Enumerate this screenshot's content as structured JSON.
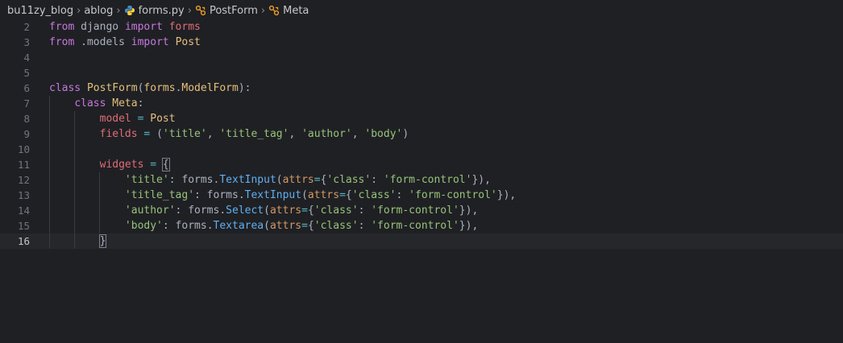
{
  "breadcrumb": {
    "items": [
      {
        "label": "bu11zy_blog",
        "icon": ""
      },
      {
        "label": "ablog",
        "icon": ""
      },
      {
        "label": "forms.py",
        "icon": "python-icon"
      },
      {
        "label": "PostForm",
        "icon": "class-icon"
      },
      {
        "label": "Meta",
        "icon": "class-icon"
      }
    ]
  },
  "colors": {
    "keyword": "#c678dd",
    "class": "#e5c07b",
    "function": "#61afef",
    "string": "#98c379",
    "variable": "#e06c75",
    "background": "#1f2024"
  },
  "editor": {
    "current_line": 16,
    "lines": [
      {
        "n": "2",
        "tokens": [
          [
            "kw",
            "from"
          ],
          [
            "plain",
            " django "
          ],
          [
            "kw",
            "import"
          ],
          [
            "plain",
            " "
          ],
          [
            "var",
            "forms"
          ]
        ]
      },
      {
        "n": "3",
        "tokens": [
          [
            "kw",
            "from"
          ],
          [
            "plain",
            " .models "
          ],
          [
            "kw",
            "import"
          ],
          [
            "plain",
            " "
          ],
          [
            "cls",
            "Post"
          ]
        ]
      },
      {
        "n": "4",
        "tokens": []
      },
      {
        "n": "5",
        "tokens": []
      },
      {
        "n": "6",
        "tokens": [
          [
            "kw",
            "class"
          ],
          [
            "plain",
            " "
          ],
          [
            "cls",
            "PostForm"
          ],
          [
            "pun",
            "("
          ],
          [
            "cls",
            "forms"
          ],
          [
            "pun",
            "."
          ],
          [
            "cls",
            "ModelForm"
          ],
          [
            "pun",
            "):"
          ]
        ]
      },
      {
        "n": "7",
        "tokens": [
          [
            "plain",
            "    "
          ],
          [
            "kw",
            "class"
          ],
          [
            "plain",
            " "
          ],
          [
            "cls",
            "Meta"
          ],
          [
            "pun",
            ":"
          ]
        ]
      },
      {
        "n": "8",
        "tokens": [
          [
            "plain",
            "        "
          ],
          [
            "var",
            "model"
          ],
          [
            "plain",
            " "
          ],
          [
            "op",
            "="
          ],
          [
            "plain",
            " "
          ],
          [
            "cls",
            "Post"
          ]
        ]
      },
      {
        "n": "9",
        "tokens": [
          [
            "plain",
            "        "
          ],
          [
            "var",
            "fields"
          ],
          [
            "plain",
            " "
          ],
          [
            "op",
            "="
          ],
          [
            "plain",
            " ("
          ],
          [
            "str",
            "'title'"
          ],
          [
            "pun",
            ", "
          ],
          [
            "str",
            "'title_tag'"
          ],
          [
            "pun",
            ", "
          ],
          [
            "str",
            "'author'"
          ],
          [
            "pun",
            ", "
          ],
          [
            "str",
            "'body'"
          ],
          [
            "pun",
            ")"
          ]
        ]
      },
      {
        "n": "10",
        "tokens": []
      },
      {
        "n": "11",
        "tokens": [
          [
            "plain",
            "        "
          ],
          [
            "var",
            "widgets"
          ],
          [
            "plain",
            " "
          ],
          [
            "op",
            "="
          ],
          [
            "plain",
            " "
          ],
          [
            "pun",
            "{"
          ]
        ]
      },
      {
        "n": "12",
        "tokens": [
          [
            "plain",
            "            "
          ],
          [
            "str",
            "'title'"
          ],
          [
            "pun",
            ": "
          ],
          [
            "plain",
            "forms"
          ],
          [
            "pun",
            "."
          ],
          [
            "fn",
            "TextInput"
          ],
          [
            "pun",
            "("
          ],
          [
            "pname",
            "attrs"
          ],
          [
            "op",
            "="
          ],
          [
            "pun",
            "{"
          ],
          [
            "str",
            "'class'"
          ],
          [
            "pun",
            ": "
          ],
          [
            "str",
            "'form-control'"
          ],
          [
            "pun",
            "}),"
          ]
        ]
      },
      {
        "n": "13",
        "tokens": [
          [
            "plain",
            "            "
          ],
          [
            "str",
            "'title_tag'"
          ],
          [
            "pun",
            ": "
          ],
          [
            "plain",
            "forms"
          ],
          [
            "pun",
            "."
          ],
          [
            "fn",
            "TextInput"
          ],
          [
            "pun",
            "("
          ],
          [
            "pname",
            "attrs"
          ],
          [
            "op",
            "="
          ],
          [
            "pun",
            "{"
          ],
          [
            "str",
            "'class'"
          ],
          [
            "pun",
            ": "
          ],
          [
            "str",
            "'form-control'"
          ],
          [
            "pun",
            "}),"
          ]
        ]
      },
      {
        "n": "14",
        "tokens": [
          [
            "plain",
            "            "
          ],
          [
            "str",
            "'author'"
          ],
          [
            "pun",
            ": "
          ],
          [
            "plain",
            "forms"
          ],
          [
            "pun",
            "."
          ],
          [
            "fn",
            "Select"
          ],
          [
            "pun",
            "("
          ],
          [
            "pname",
            "attrs"
          ],
          [
            "op",
            "="
          ],
          [
            "pun",
            "{"
          ],
          [
            "str",
            "'class'"
          ],
          [
            "pun",
            ": "
          ],
          [
            "str",
            "'form-control'"
          ],
          [
            "pun",
            "}),"
          ]
        ]
      },
      {
        "n": "15",
        "tokens": [
          [
            "plain",
            "            "
          ],
          [
            "str",
            "'body'"
          ],
          [
            "pun",
            ": "
          ],
          [
            "plain",
            "forms"
          ],
          [
            "pun",
            "."
          ],
          [
            "fn",
            "Textarea"
          ],
          [
            "pun",
            "("
          ],
          [
            "pname",
            "attrs"
          ],
          [
            "op",
            "="
          ],
          [
            "pun",
            "{"
          ],
          [
            "str",
            "'class'"
          ],
          [
            "pun",
            ": "
          ],
          [
            "str",
            "'form-control'"
          ],
          [
            "pun",
            "}),"
          ]
        ]
      },
      {
        "n": "16",
        "tokens": [
          [
            "plain",
            "        "
          ],
          [
            "pun",
            "}"
          ]
        ]
      }
    ]
  }
}
